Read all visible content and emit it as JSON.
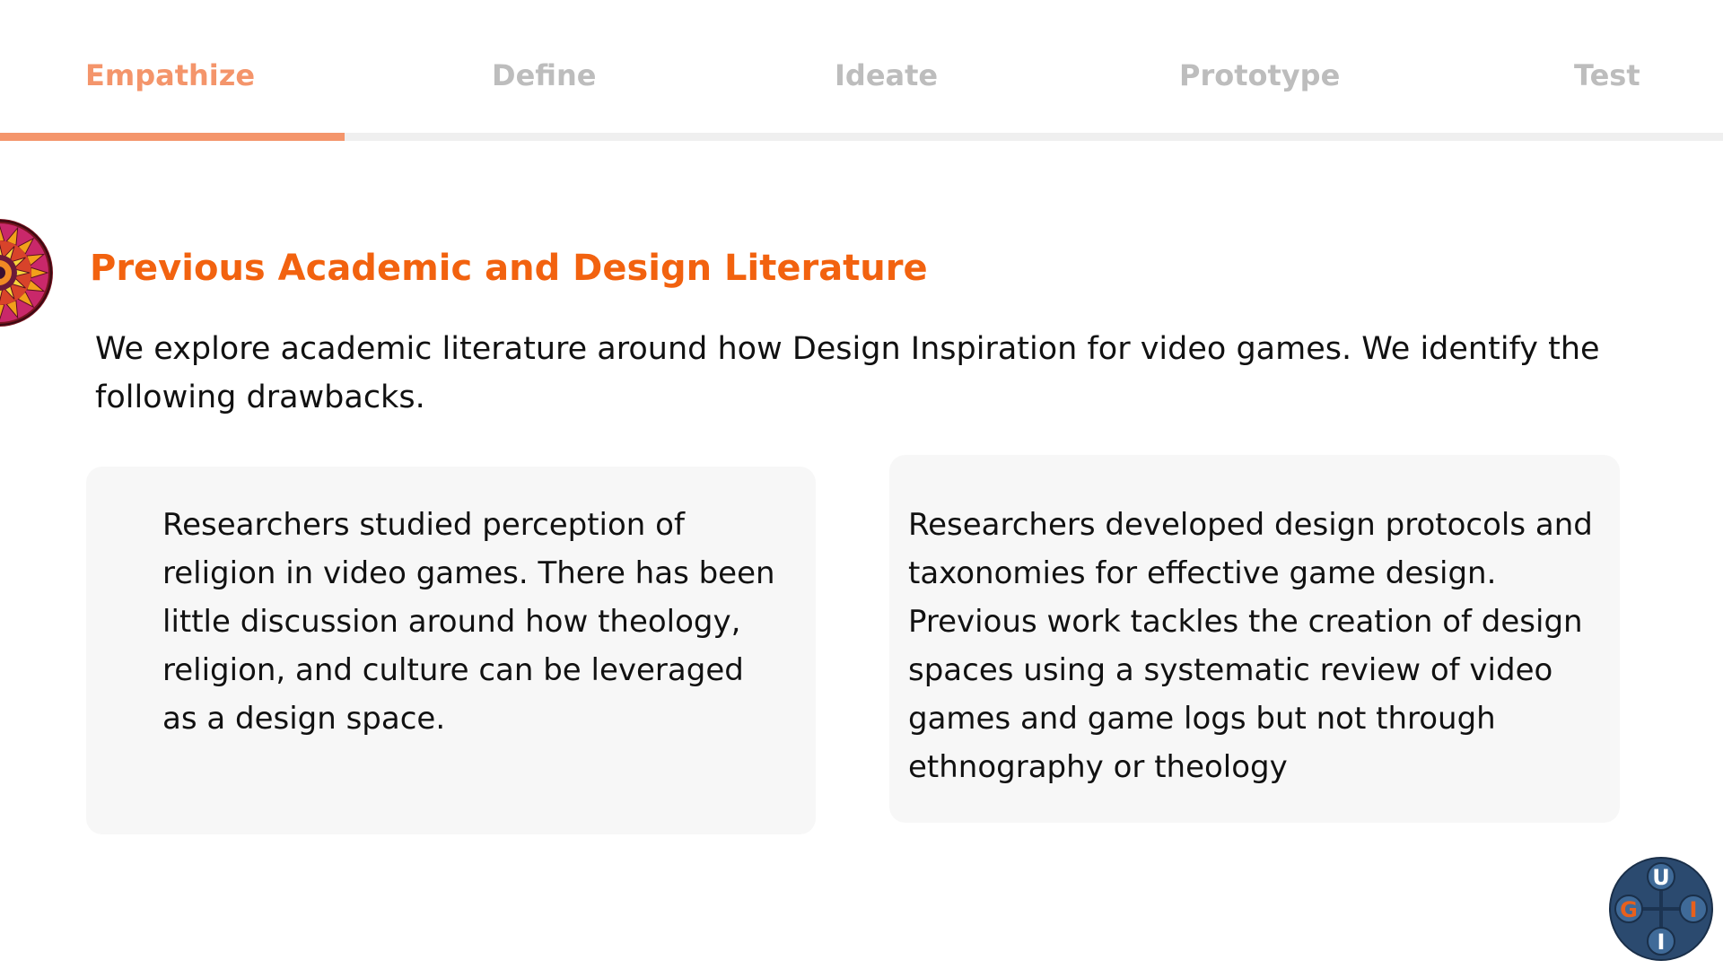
{
  "tabs": [
    {
      "label": "Empathize",
      "active": true
    },
    {
      "label": "Define",
      "active": false
    },
    {
      "label": "Ideate",
      "active": false
    },
    {
      "label": "Prototype",
      "active": false
    },
    {
      "label": "Test",
      "active": false
    }
  ],
  "progress": {
    "current_step": 1,
    "total_steps": 5,
    "fraction": 0.2
  },
  "section": {
    "title": "Previous Academic and Design Literature",
    "intro": "We explore academic literature around how Design Inspiration for video games. We identify the following drawbacks."
  },
  "cards": [
    {
      "text": "Researchers studied perception of religion in video games. There has been little discussion around how theology, religion, and culture can be leveraged as a design space."
    },
    {
      "text": "Researchers developed design protocols and taxonomies for effective game design. Previous work tackles the creation of design spaces using a systematic review of video games and game logs but not through ethnography or theology"
    }
  ],
  "logo": {
    "letters": [
      "U",
      "G",
      "I",
      "I"
    ]
  },
  "colors": {
    "accent": "#f4956b",
    "title": "#f2620f",
    "inactive_tab": "#bdbdbd",
    "card_bg": "#f7f7f7",
    "logo_navy": "#2b4a6f",
    "logo_orange": "#e8601c"
  },
  "icons": {
    "mandala": "mandala-icon",
    "logo": "gui-logo-icon"
  }
}
